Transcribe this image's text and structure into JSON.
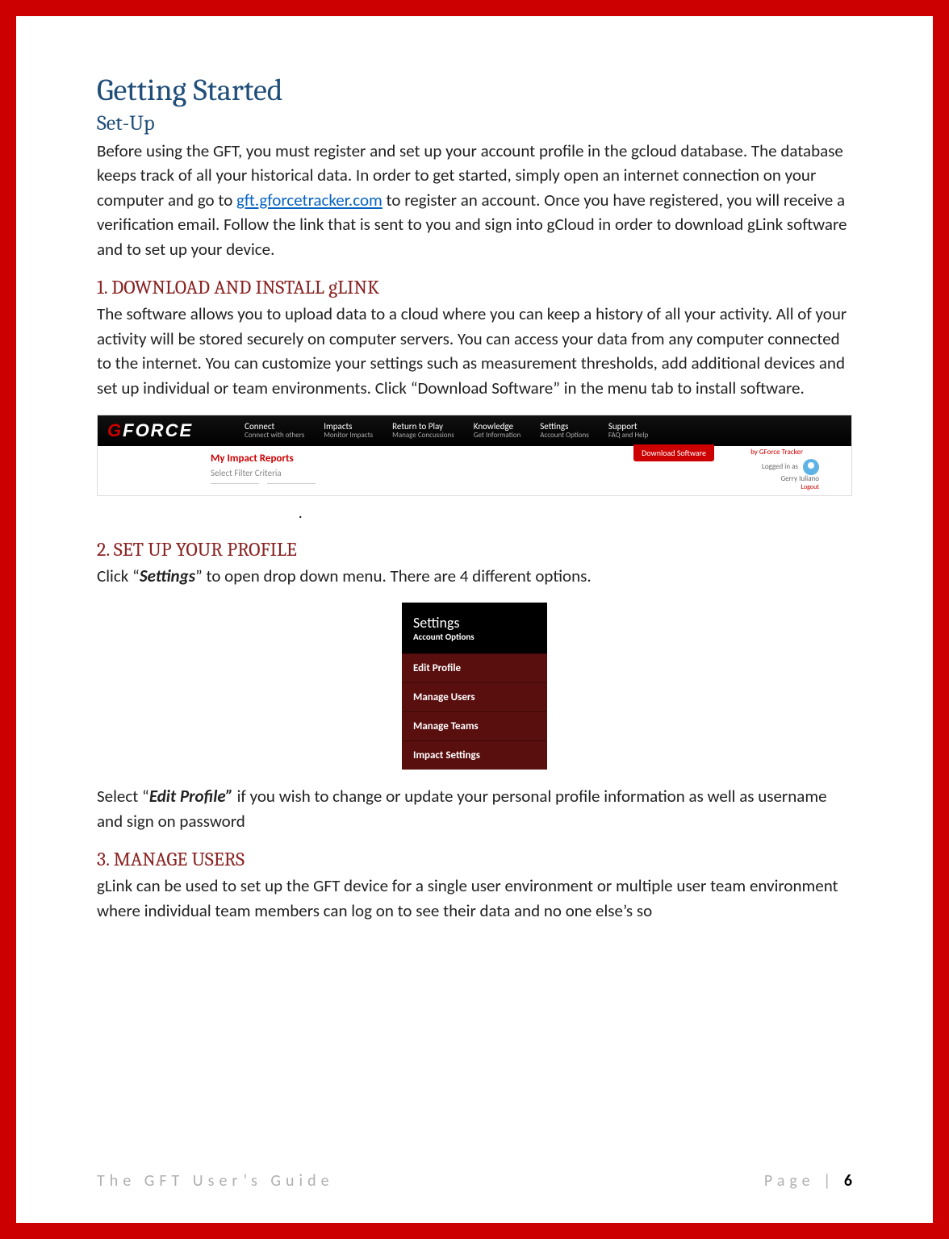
{
  "h1": "Getting Started",
  "h2_setup": "Set-Up",
  "intro_before_link": "Before using the GFT, you must register and set up your account profile in the gcloud database. The database keeps track of all your historical data. In order to get started, simply open an internet connection on your computer and go to ",
  "intro_link": "gft.gforcetracker.com",
  "intro_after_link": " to register an account. Once you have registered, you will receive a verification email. Follow the link that is sent to you and sign into gCloud in order to download gLink software and to set up your device.",
  "section1_title": "1. DOWNLOAD AND INSTALL gLINK",
  "section1_body": "The software allows you to upload data to a cloud where you can keep a history of all your activity.  All of your activity will be stored securely on computer servers. You can access your data from any computer connected to the internet.  You can customize your settings such as measurement thresholds, add additional devices and set up individual or team environments. Click “Download Software” in the menu tab to install software.",
  "navshot": {
    "logo_g": "G",
    "logo_rest": "FORCE",
    "items": [
      {
        "label": "Connect",
        "sub": "Connect with others"
      },
      {
        "label": "Impacts",
        "sub": "Monitor Impacts"
      },
      {
        "label": "Return to Play",
        "sub": "Manage Concussions"
      },
      {
        "label": "Knowledge",
        "sub": "Get Information"
      },
      {
        "label": "Settings",
        "sub": "Account Options"
      },
      {
        "label": "Support",
        "sub": "FAQ and Help"
      }
    ],
    "reports_title": "My Impact Reports",
    "filter_label": "Select Filter Criteria",
    "download_btn": "Download Software",
    "byline": "by GForce Tracker",
    "logged_in_as": "Logged in as",
    "user_name": "Gerry Iuliano",
    "logout": "Logout"
  },
  "dot": ".",
  "section2_title": "2. SET UP YOUR PROFILE",
  "section2_body_pre": "Click “",
  "section2_body_bold": "Settings",
  "section2_body_post": "” to open drop down menu. There are 4 different options.",
  "dropdown": {
    "title": "Settings",
    "subtitle": "Account Options",
    "items": [
      "Edit Profile",
      "Manage Users",
      "Manage Teams",
      "Impact Settings"
    ]
  },
  "section2_footer_pre": "Select “",
  "section2_footer_bold": "Edit Profile”",
  "section2_footer_post": " if you wish to change or update your personal profile information as well as username and sign on password",
  "section3_title": "3. MANAGE USERS",
  "section3_body": "gLink can be used to set up the GFT device for a single user environment or multiple user team environment where individual team members can log on to see their data and no one else’s so",
  "footer_left": "The GFT User’s Guide",
  "footer_page_label": "Page | ",
  "footer_page_num": "6"
}
